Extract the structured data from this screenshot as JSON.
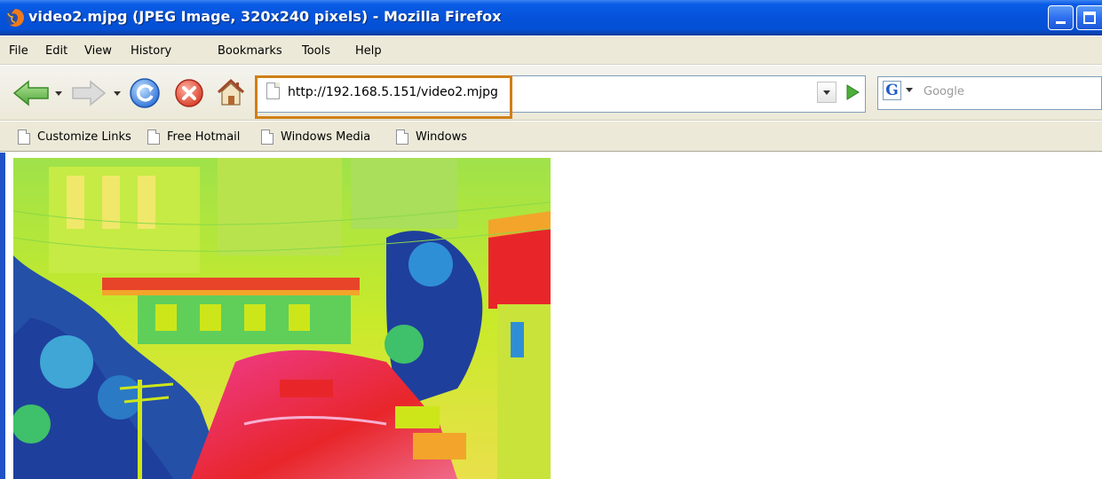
{
  "window": {
    "title": "video2.mjpg (JPEG Image, 320x240 pixels) - Mozilla Firefox",
    "app_icon": "firefox-icon"
  },
  "menu": {
    "items": [
      "File",
      "Edit",
      "View",
      "History",
      "Bookmarks",
      "Tools",
      "Help"
    ]
  },
  "toolbar": {
    "icons": [
      "back-arrow-icon",
      "forward-arrow-icon",
      "reload-icon",
      "stop-icon",
      "home-icon"
    ],
    "url": "http://192.168.5.151/video2.mjpg",
    "search_placeholder": "Google",
    "search_engine_icon": "google-g-icon",
    "highlight_color": "#d07f17"
  },
  "bookmarks": {
    "items": [
      "Customize Links",
      "Free Hotmail",
      "Windows Media",
      "Windows"
    ]
  },
  "content": {
    "image": "thermal-camera-image",
    "palette": [
      "#1f3f9c",
      "#2f8fd6",
      "#3fc06a",
      "#cde61a",
      "#f2a52a",
      "#e8262a",
      "#ef3c8f"
    ]
  }
}
